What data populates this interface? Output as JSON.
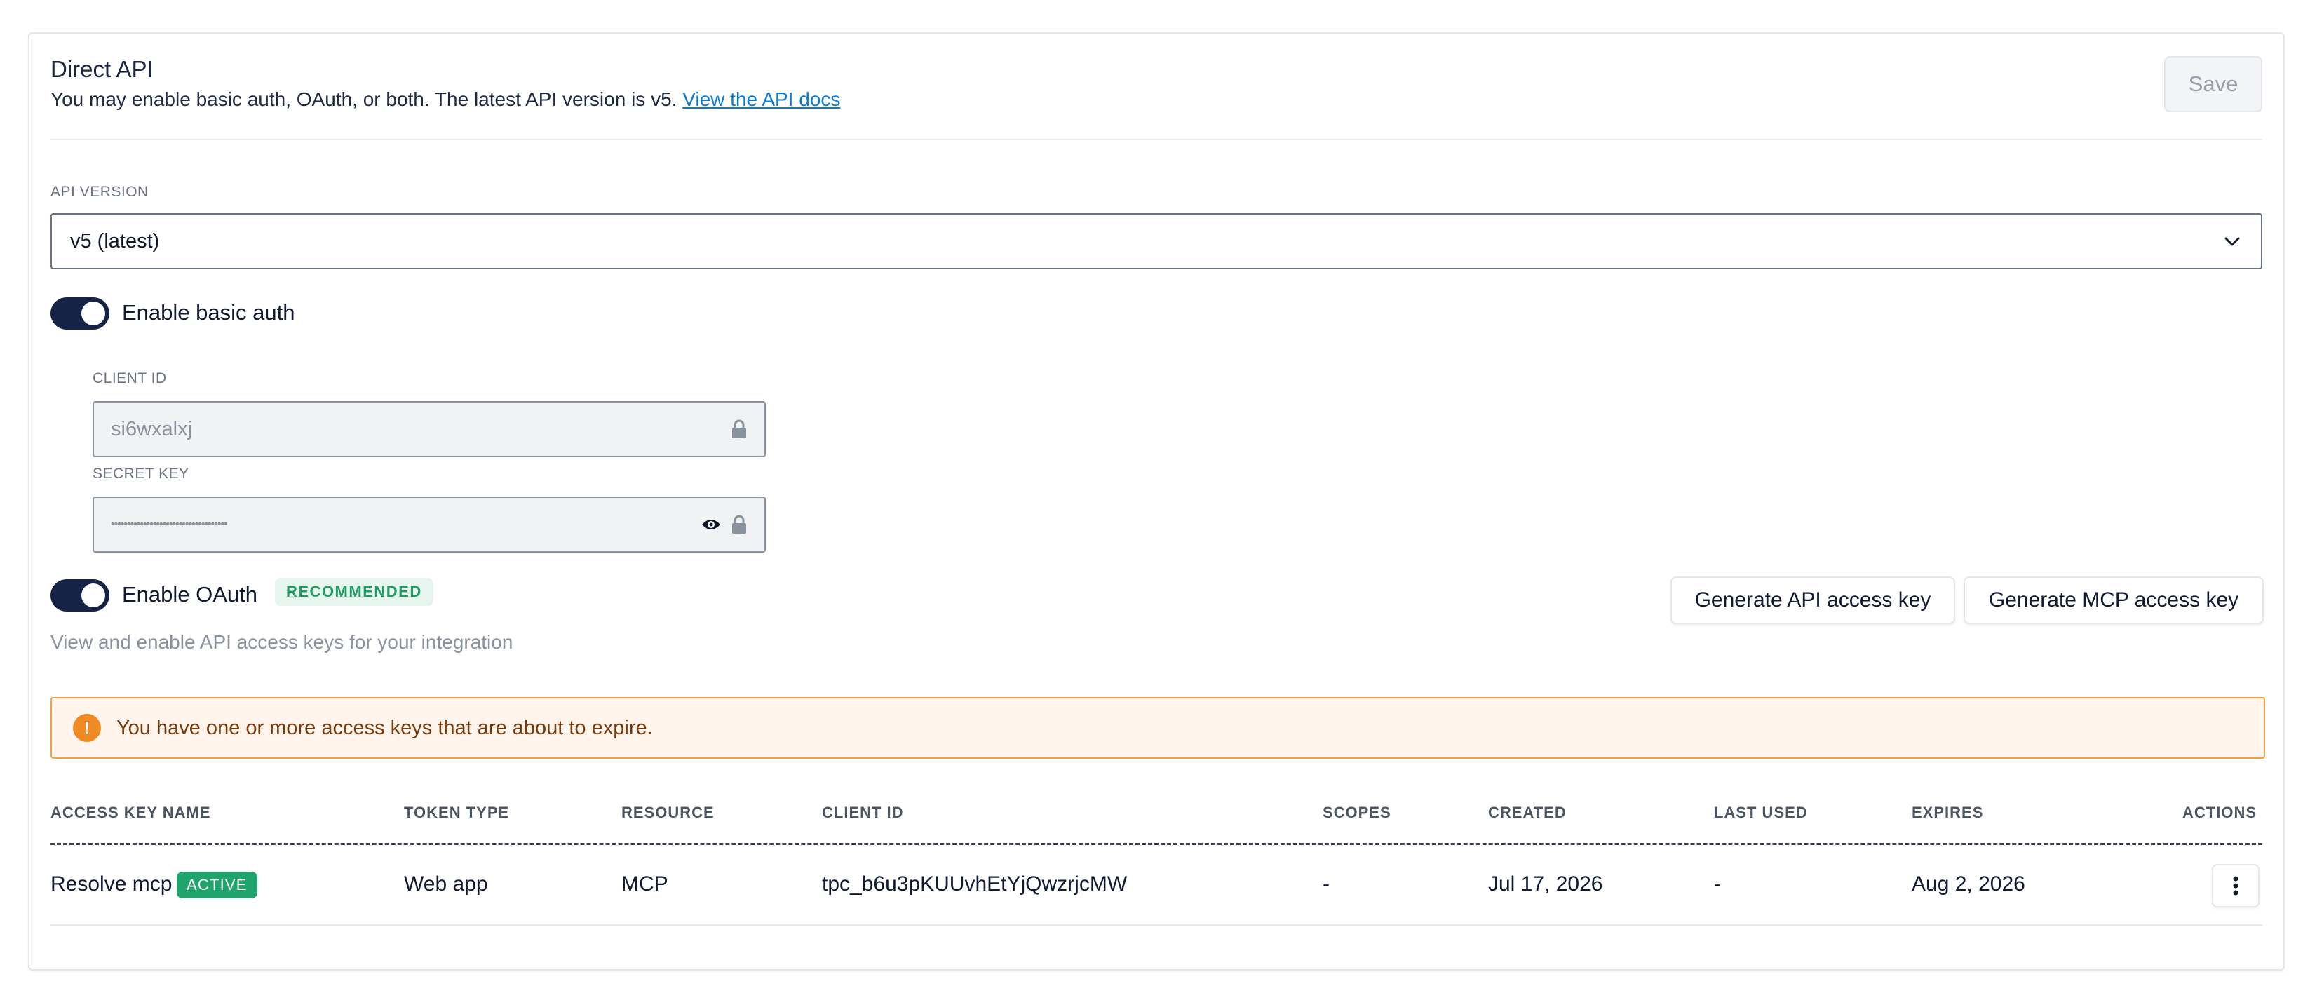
{
  "section": {
    "title": "Direct API",
    "subtitle_text": "You may enable basic auth, OAuth, or both. The latest API version is v5.",
    "docs_link": "View the API docs",
    "save_label": "Save"
  },
  "api_version": {
    "label": "API VERSION",
    "selected": "v5 (latest)"
  },
  "basic_auth": {
    "toggle_label": "Enable basic auth",
    "enabled": true,
    "client_id_label": "CLIENT ID",
    "client_id_value": "si6wxalxj",
    "secret_key_label": "SECRET KEY",
    "secret_key_value": "••••••••••••••••••••••••••••••••••••"
  },
  "oauth": {
    "toggle_label": "Enable OAuth",
    "enabled": true,
    "badge": "RECOMMENDED",
    "helper": "View and enable API access keys for your integration",
    "generate_api_label": "Generate API access key",
    "generate_mcp_label": "Generate MCP access key"
  },
  "alert": {
    "message": "You have one or more access keys that are about to expire.",
    "icon_glyph": "!",
    "color": "#f08a24"
  },
  "table": {
    "headers": [
      "ACCESS KEY NAME",
      "TOKEN TYPE",
      "RESOURCE",
      "CLIENT ID",
      "SCOPES",
      "CREATED",
      "LAST USED",
      "EXPIRES",
      "ACTIONS"
    ],
    "rows": [
      {
        "name": "Resolve mcp",
        "status": "ACTIVE",
        "token_type": "Web app",
        "resource": "MCP",
        "client_id": "tpc_b6u3pKUUvhEtYjQwzrjcMW",
        "scopes": "-",
        "created": "Jul 17, 2026",
        "last_used": "-",
        "expires": "Aug 2, 2026"
      }
    ]
  },
  "colors": {
    "toggle_on": "#152446",
    "link": "#0b7bd6",
    "success": "#1fa56b",
    "warning_border": "#f4a24a"
  }
}
